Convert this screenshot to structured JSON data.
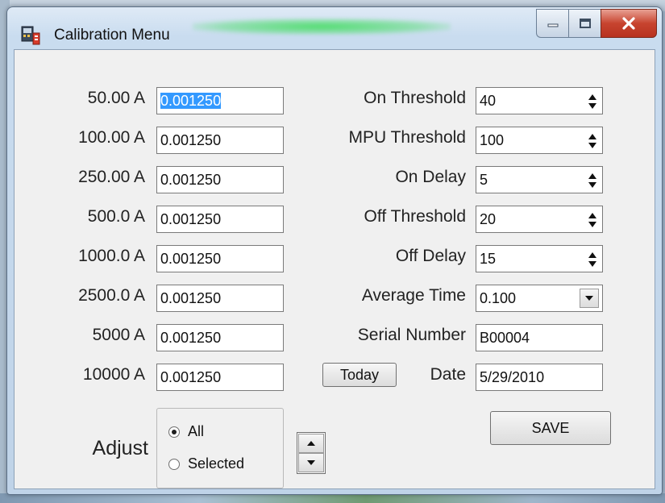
{
  "window": {
    "title": "Calibration Menu"
  },
  "calibration_rows": [
    {
      "label": "50.00 A",
      "value": "0.001250"
    },
    {
      "label": "100.00 A",
      "value": "0.001250"
    },
    {
      "label": "250.00 A",
      "value": "0.001250"
    },
    {
      "label": "500.0 A",
      "value": "0.001250"
    },
    {
      "label": "1000.0 A",
      "value": "0.001250"
    },
    {
      "label": "2500.0 A",
      "value": "0.001250"
    },
    {
      "label": "5000 A",
      "value": "0.001250"
    },
    {
      "label": "10000 A",
      "value": "0.001250"
    }
  ],
  "settings": {
    "on_threshold": {
      "label": "On Threshold",
      "value": "40"
    },
    "mpu_threshold": {
      "label": "MPU Threshold",
      "value": "100"
    },
    "on_delay": {
      "label": "On Delay",
      "value": "5"
    },
    "off_threshold": {
      "label": "Off Threshold",
      "value": "20"
    },
    "off_delay": {
      "label": "Off Delay",
      "value": "15"
    },
    "average_time": {
      "label": "Average Time",
      "value": "0.100"
    },
    "serial_number": {
      "label": "Serial Number",
      "value": "B00004"
    },
    "date": {
      "label": "Date",
      "value": "5/29/2010",
      "today_button": "Today"
    }
  },
  "adjust": {
    "label": "Adjust",
    "options": [
      "All",
      "Selected"
    ],
    "selected": "All"
  },
  "save_button": "SAVE",
  "icons": {
    "app": "calibration-app-icon",
    "minimize": "minimize-icon",
    "maximize": "maximize-icon",
    "close": "close-icon",
    "spin": "spin-arrows-icon",
    "dropdown": "dropdown-arrow-icon"
  },
  "colors": {
    "selection": "#3399ff",
    "close_button": "#c7442f",
    "title_glow": "#3cdc5a"
  }
}
